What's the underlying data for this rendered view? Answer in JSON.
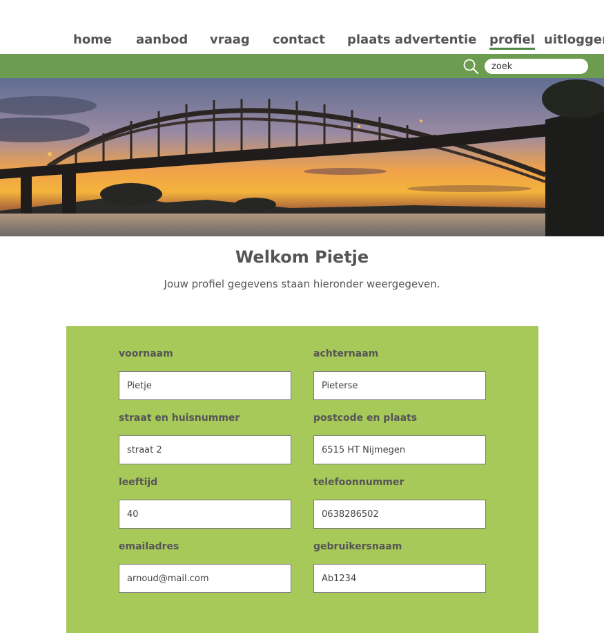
{
  "nav": {
    "items": [
      {
        "label": "home"
      },
      {
        "label": "aanbod"
      },
      {
        "label": "vraag"
      },
      {
        "label": "contact"
      },
      {
        "label": "plaats advertentie"
      },
      {
        "label": "profiel",
        "active": true
      },
      {
        "label": "uitloggen"
      }
    ]
  },
  "search": {
    "value": "zoek"
  },
  "hero": {
    "image": "bridge-sunset-photo"
  },
  "main": {
    "title": "Welkom Pietje",
    "subtitle": "Jouw profiel gegevens staan hieronder weergegeven."
  },
  "form": {
    "fields": [
      {
        "label": "voornaam",
        "value": "Pietje"
      },
      {
        "label": "achternaam",
        "value": "Pieterse"
      },
      {
        "label": "straat en huisnummer",
        "value": "straat 2"
      },
      {
        "label": "postcode en plaats",
        "value": "6515 HT Nijmegen"
      },
      {
        "label": "leeftijd",
        "value": "40"
      },
      {
        "label": "telefoonnummer",
        "value": "0638286502"
      },
      {
        "label": "emailadres",
        "value": "arnoud@mail.com"
      },
      {
        "label": "gebruikersnaam",
        "value": "Ab1234"
      }
    ]
  },
  "colors": {
    "nav_bar": "#6b9c4f",
    "form_background": "#a7c95a",
    "active_underline": "#4e8a45",
    "text": "#555555"
  }
}
